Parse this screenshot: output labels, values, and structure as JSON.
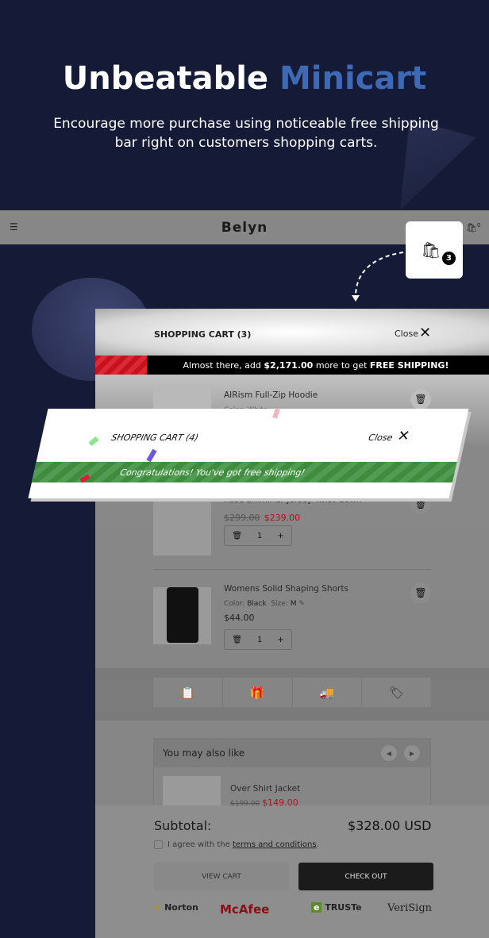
{
  "hero": {
    "title_part1": "Unbeatable",
    "title_part2": "Minicart",
    "subtitle": "Encourage more purchase using noticeable free shipping bar right on customers shopping carts."
  },
  "store": {
    "logo": "Belyn",
    "cart_count": "3",
    "small_cart_count": "0"
  },
  "cart": {
    "title": "SHOPPING CART (3)",
    "close": "Close",
    "shipping_msg_prefix": "Almost there, add ",
    "shipping_amount": "$2,171.00",
    "shipping_msg_mid": " more to get ",
    "shipping_msg_bold": "FREE SHIPPING!",
    "shipping_progress_percent": 13,
    "items": [
      {
        "name": "AIRism Full-Zip Hoodie",
        "variant": "Color: White"
      },
      {
        "name": "Rose Shimmer Jersey Twist Gown",
        "old_price": "$299.00",
        "price": "$239.00",
        "qty": "1"
      },
      {
        "name": "Womens Solid Shaping Shorts",
        "color_label": "Color:",
        "color": "Black",
        "size_label": "Size:",
        "size": "M",
        "price": "$44.00",
        "qty": "1"
      }
    ],
    "tools": [
      "note-icon",
      "gift-icon",
      "truck-icon",
      "tag-icon"
    ],
    "upsell": {
      "title": "You may also like",
      "items": [
        {
          "name": "Over Shirt Jacket",
          "old_price": "$199.00",
          "price": "$149.00"
        }
      ]
    },
    "subtotal_label": "Subtotal:",
    "subtotal": "$328.00 USD",
    "agree_prefix": "I agree with the ",
    "agree_link": "terms and conditions",
    "agree_suffix": ".",
    "view_cart": "VIEW CART",
    "checkout": "CHECK OUT",
    "trust": [
      "Norton",
      "McAfee",
      "TRUSTe",
      "VeriSign"
    ]
  },
  "overlay": {
    "title": "SHOPPING CART (4)",
    "close": "Close",
    "message": "Congratulations! You've got free shipping!"
  },
  "colors": {
    "background": "#151a36",
    "accent": "#3e6ab5",
    "progress_red": "#c8101e",
    "success_green": "#3f8c3f",
    "sale_red": "#b3121b"
  }
}
